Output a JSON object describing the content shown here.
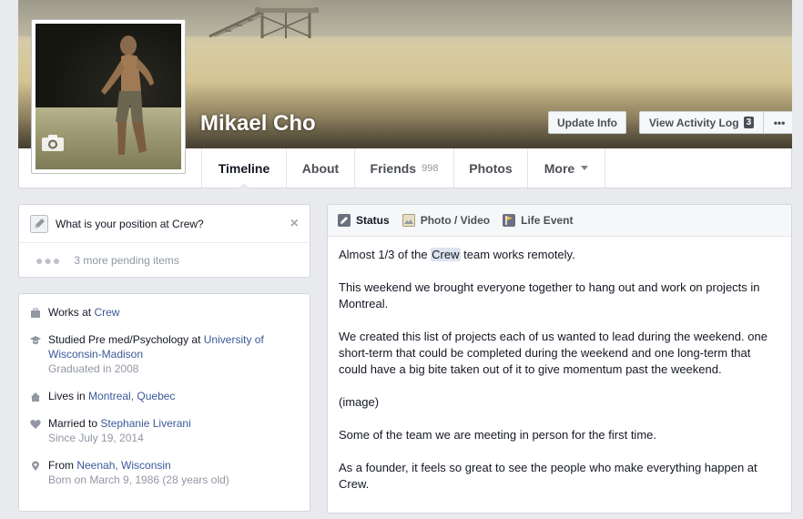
{
  "profile": {
    "name": "Mikael Cho"
  },
  "cover_buttons": {
    "update_info": "Update Info",
    "view_activity_log": "View Activity Log",
    "activity_badge": "3",
    "more": "•••"
  },
  "nav": {
    "tabs": [
      {
        "label": "Timeline"
      },
      {
        "label": "About"
      },
      {
        "label": "Friends",
        "count": "998"
      },
      {
        "label": "Photos"
      },
      {
        "label": "More"
      }
    ]
  },
  "question_card": {
    "question": "What is your position at Crew?",
    "close": "×",
    "pending_dots": "●●●",
    "pending": "3 more pending items"
  },
  "about": {
    "works_prefix": "Works at ",
    "works_at": "Crew",
    "studied_prefix": "Studied Pre med/Psychology at ",
    "school": "University of Wisconsin-Madison",
    "graduated": "Graduated in 2008",
    "lives_prefix": "Lives in ",
    "lives_in": "Montreal, Quebec",
    "married_prefix": "Married to ",
    "spouse": "Stephanie Liverani",
    "married_since": "Since July 19, 2014",
    "from_prefix": "From ",
    "hometown": "Neenah, Wisconsin",
    "born": "Born on March 9, 1986 (28 years old)"
  },
  "composer": {
    "tabs": [
      {
        "label": "Status"
      },
      {
        "label": "Photo / Video"
      },
      {
        "label": "Life Event"
      }
    ],
    "p1_before": "Almost 1/3 of the ",
    "p1_tag": "Crew",
    "p1_after": " team works remotely.",
    "p2": "This weekend we brought everyone together to hang out and work on projects in Montreal.",
    "p3": "We created this list of projects each of us wanted to lead during the weekend. one short-term that could be completed during the weekend and one long-term that could have a big bite taken out of it to give momentum past the weekend.",
    "p4": "(image)",
    "p5": "Some of the team we are meeting in person for the first time.",
    "p6": "As a founder, it feels so great to see the people who make everything happen at Crew."
  },
  "colors": {
    "link": "#3b5998",
    "muted": "#9197a3",
    "page_bg": "#e9eaed"
  }
}
